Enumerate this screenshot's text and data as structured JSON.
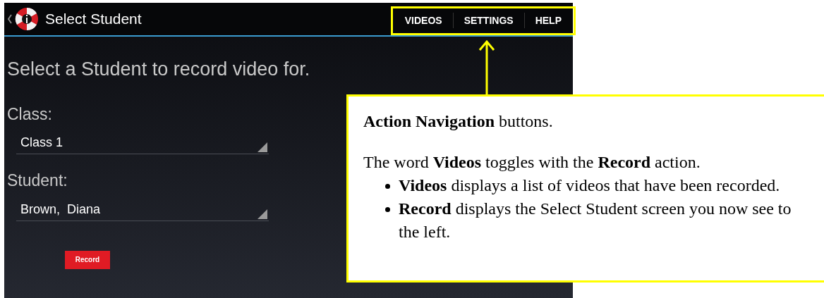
{
  "app_bar": {
    "title": "Select Student",
    "actions": [
      {
        "label": "VIDEOS"
      },
      {
        "label": "SETTINGS"
      },
      {
        "label": "HELP"
      }
    ]
  },
  "heading": "Select a Student to record video for.",
  "fields": [
    {
      "label": "Class:",
      "value": "Class 1"
    },
    {
      "label": "Student:",
      "value": "Brown,  Diana"
    }
  ],
  "record_button": "Record",
  "callout": {
    "title": "**Action Navigation** buttons.",
    "text": "The word **Videos** toggles with the **Record** action.",
    "bullets": [
      "**Videos** displays a list of videos that have been recorded.",
      "**Record** displays the Select Student screen you now see to the left."
    ]
  }
}
